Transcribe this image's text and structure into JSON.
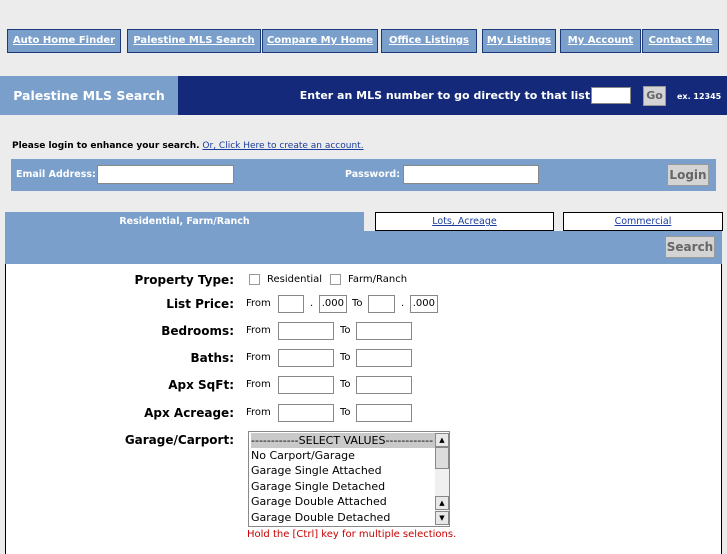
{
  "nav": {
    "items": [
      {
        "label": "Auto Home Finder"
      },
      {
        "label": "Palestine MLS Search"
      },
      {
        "label": "Compare My Home"
      },
      {
        "label": "Office Listings"
      },
      {
        "label": "My Listings"
      },
      {
        "label": "My Account"
      },
      {
        "label": "Contact Me"
      }
    ]
  },
  "header": {
    "section_title": "Palestine MLS Search",
    "mls_prompt": "Enter an MLS number to go directly to that listing:",
    "mls_input_value": "",
    "go_label": "Go",
    "example": "ex. 12345"
  },
  "login": {
    "message": "Please login to enhance your search.",
    "create_link": "Or, Click Here to create an account.",
    "email_label": "Email Address:",
    "email_value": "",
    "password_label": "Password:",
    "password_value": "",
    "login_label": "Login"
  },
  "tabs": [
    {
      "label": "Residential, Farm/Ranch",
      "active": true
    },
    {
      "label": "Lots, Acreage",
      "active": false
    },
    {
      "label": "Commercial",
      "active": false
    }
  ],
  "search_label": "Search",
  "form": {
    "property_type": {
      "label": "Property Type:",
      "options": [
        "Residential",
        "Farm/Ranch"
      ]
    },
    "list_price": {
      "label": "List Price:",
      "from": "From",
      "to": "To",
      "dot": ".",
      "thousands": ".000"
    },
    "bedrooms": {
      "label": "Bedrooms:"
    },
    "baths": {
      "label": "Baths:"
    },
    "sqft": {
      "label": "Apx SqFt:"
    },
    "acreage": {
      "label": "Apx Acreage:"
    },
    "from_label": "From",
    "to_label": "To",
    "garage": {
      "label": "Garage/Carport:",
      "options": [
        "------------SELECT VALUES------------",
        "No Carport/Garage",
        "Garage Single Attached",
        "Garage Single Detached",
        "Garage Double Attached",
        "Garage Double Detached"
      ]
    },
    "hint": "Hold the [Ctrl] key for multiple selections."
  }
}
